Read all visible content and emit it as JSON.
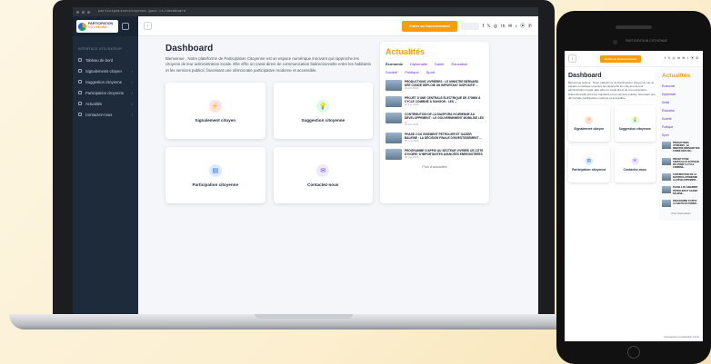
{
  "browser": {
    "url": "participationcitoyenne.gouv.ci/dashboard"
  },
  "brand": {
    "line1": "PARTICIPATION",
    "line2": "CITOYENNE"
  },
  "sidebar": {
    "section": "INTERFACE UTILISATEUR",
    "items": [
      {
        "label": "Tableau de bord",
        "chevron": ""
      },
      {
        "label": "Signalements citoyen",
        "chevron": "›"
      },
      {
        "label": "Suggestion citoyenne",
        "chevron": "›"
      },
      {
        "label": "Participation citoyenne",
        "chevron": "›"
      },
      {
        "label": "Actualités",
        "chevron": "›"
      },
      {
        "label": "Contactez-nous",
        "chevron": "›"
      }
    ]
  },
  "topbar": {
    "menu": "⁝",
    "cta": "Entrer au Gouvernement",
    "social": "f 𝕏 ◎ in ✉ ♪ ⦿ ✆"
  },
  "dashboard": {
    "title": "Dashboard",
    "intro": "Bienvenue , Notre plateforme de Participation Citoyenne est un espace numérique innovant qui rapproche les citoyens de leur administration locale. Elle offre un canal direct de communication bidirectionnelle entre les habitants et les services publics, favorisant une démocratie participative moderne et accessible.",
    "cards": [
      {
        "label": "Signalement citoyen",
        "icon": "⚡",
        "bg": "#fde2e4",
        "color": "#e11d48"
      },
      {
        "label": "Suggestion citoyenne",
        "icon": "💡",
        "bg": "#dcfce7",
        "color": "#16a34a"
      },
      {
        "label": "Participation citoyenne",
        "icon": "▤",
        "bg": "#dbeafe",
        "color": "#2563eb"
      },
      {
        "label": "Contactez-nous",
        "icon": "✉",
        "bg": "#ede9fe",
        "color": "#7c3aed"
      }
    ]
  },
  "news": {
    "title": "Actualités",
    "tabs": [
      "Économie",
      "Diplomatie",
      "Santé",
      "Éducation",
      "Société",
      "Politique",
      "Sport"
    ],
    "items": [
      {
        "headline": "PRODUCTIONS VIVRIÈRES : LE MINISTRE BÉRNARD KÉE CONDÉ DÉPLOIE UN IMPORTANT DISPOSITIF ...",
        "date": "20 juin 2025"
      },
      {
        "headline": "PROJET D'UNE CENTRALE ÉLECTRIQUE DE 370MW À CYCLE COMBINÉ À SONGON : LES ...",
        "date": "20 juin 2025"
      },
      {
        "headline": "CONTRIBUTION DE LA DIASPORA IVOIRIENNE AU DÉVELOPPEMENT : LE GOUVERNEMENT MOBILISE LES ...",
        "date": "20 juin 2025"
      },
      {
        "headline": "PHASE 2 DU GISEMENT PÉTROLIER ET GAZIER BALEINE : LA DÉCISION FINALE D'INVESTISSEMENT ...",
        "date": "20 mai 2025"
      },
      {
        "headline": "PROGRAMME D'APPUI AU SECTEUR VIVRIER/ UE-CÔTE D'IVOIRE: D'IMPORTANTES AVANCÉES ENREGISTRÉES",
        "date": "20 mai 2025"
      }
    ],
    "more": "Plus d'actualités"
  },
  "phone": {
    "status": "PARTICIPATION CITOYENNE",
    "cta": "Entrer au Gouvernement",
    "intro": "Bienvenue visiteur , Notre plateforme de Participation Citoyenne est un espace numérique innovant qui rapproche les citoyens de leur administration locale. Elle offre un canal direct de communication bidirectionnelle entre les habitants et les services publics, favorisant une démocratie participative moderne et accessible.",
    "tabs": [
      "Économie",
      "Diplomatie",
      "Santé",
      "Éducation",
      "Société",
      "Politique",
      "Sport"
    ],
    "items": [
      "PRODUCTIONS VIVRIÈRES : LE MINISTRE BÉRNARD KÉE CONDÉ DÉPLOIE...",
      "PROJET D'UNE CENTRALE ÉLECTRIQUE DE 370MW À CYCLE COMBINÉ...",
      "CONTRIBUTION DE LA DIASPORA IVOIRIENNE AU DÉVELOPPEMENT...",
      "PHASE 2 DU GISEMENT PÉTROLIER ET GAZIER BALEINE...",
      "PROGRAMME D'APPUI AU SECTEUR VIVRIER..."
    ],
    "footer": "Conception et réalisation CICG"
  }
}
